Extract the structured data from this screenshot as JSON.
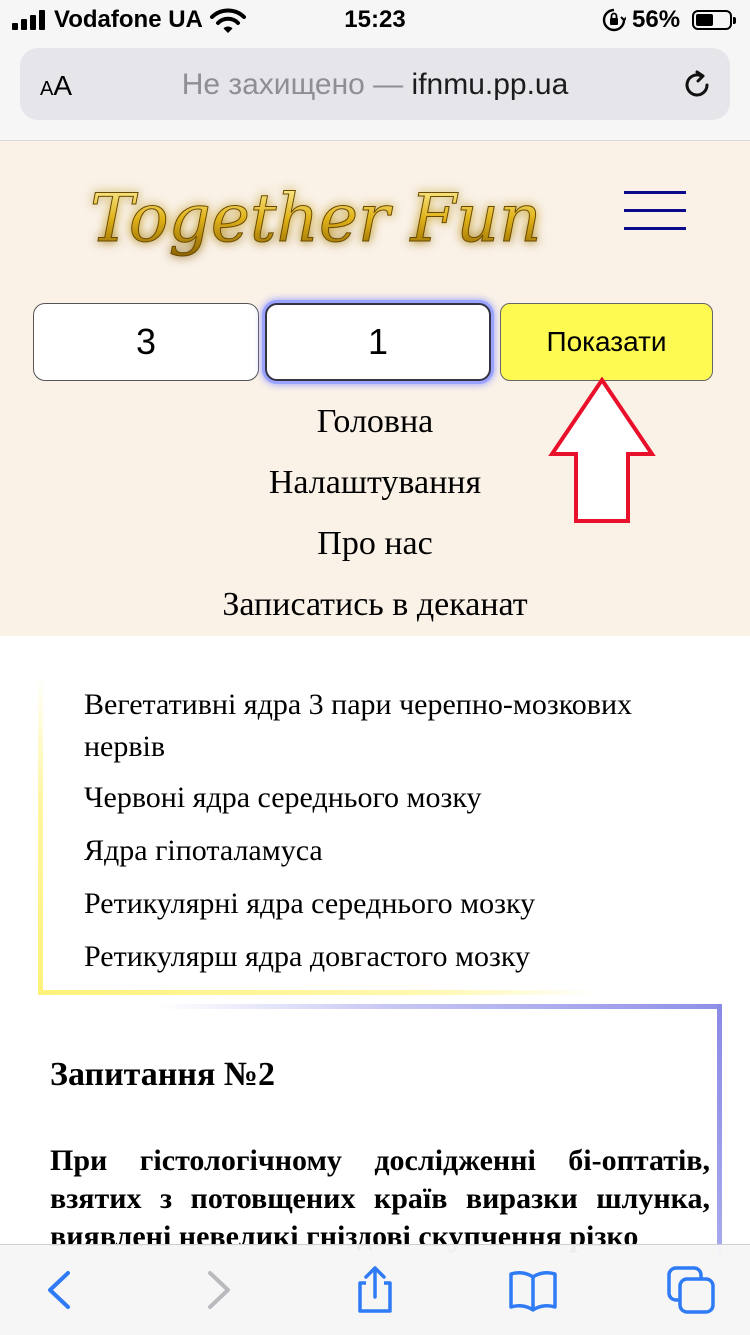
{
  "status_bar": {
    "carrier": "Vodafone UA",
    "time": "15:23",
    "battery": "56%",
    "battery_level": 0.56,
    "icons": [
      "signal-icon",
      "wifi-icon",
      "rotation-lock-icon",
      "battery-icon"
    ]
  },
  "browser": {
    "text_size_label": "AA",
    "url_prefix": "Не захищено — ",
    "url_domain": "ifnmu.pp.ua",
    "icons": [
      "reload-icon",
      "back-icon",
      "forward-icon",
      "share-icon",
      "bookmarks-icon",
      "tabs-icon"
    ]
  },
  "header": {
    "logo_text": "Together Fun",
    "inputs": {
      "first_value": "3",
      "second_value": "1"
    },
    "show_button": "Показати",
    "nav": [
      "Головна",
      "Налаштування",
      "Про нас",
      "Записатись в деканат"
    ]
  },
  "answers": [
    "Вегетативні ядра 3 пари черепно-мозкових нервів",
    "Червоні ядра середнього мозку",
    "Ядра гіпоталамуса",
    "Ретикулярні ядра середнього мозку",
    "Ретикулярш ядра довгастого мозку"
  ],
  "question": {
    "title": "Запитання №2",
    "text": "При гістологічному дослідженні бі-оптатів, взятих з потовщених країв виразки шлунка, виявлені невеликі гніздові скупчення різко"
  },
  "colors": {
    "header_bg": "#faf1e7",
    "button_yellow": "#fffa52",
    "annotation_red": "#e8102a",
    "ios_blue": "#2f7bf5"
  }
}
